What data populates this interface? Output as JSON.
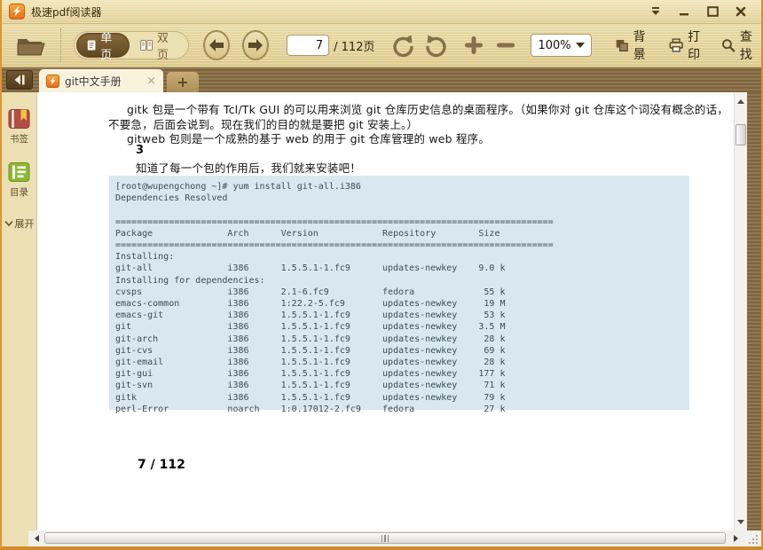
{
  "window": {
    "title": "极速pdf阅读器"
  },
  "toolbar": {
    "single_page_label": "单页",
    "double_page_label": "双页",
    "page_current": "7",
    "page_total": "/ 112页",
    "zoom_value": "100%",
    "background_label": "背景",
    "print_label": "打印",
    "find_label": "查找"
  },
  "tabbar": {
    "active_tab_title": "git中文手册",
    "close_glyph": "×",
    "new_tab_glyph": "+"
  },
  "sidebar": {
    "bookmark_label": "书签",
    "toc_label": "目录",
    "expand_label": "展开"
  },
  "document": {
    "paragraph_lines": [
      "gitk 包是一个带有 Tcl/Tk GUI 的可以用来浏览 git 仓库历史信息的桌面程序。（如果你对 git 仓库这个词没有概念的话，",
      "不要急，后面会说到。现在我们的目的就是要把 git 安装上。）",
      "gitweb 包则是一个成熟的基于 web 的用于 git 仓库管理的 web 程序。",
      "3",
      "知道了每一个包的作用后，我们就来安装吧！"
    ],
    "terminal_lines": [
      "[root@wupengchong ~]# yum install git-all.i386",
      "Dependencies Resolved",
      "",
      "==================================================================================",
      "Package              Arch      Version            Repository        Size",
      "==================================================================================",
      "Installing:",
      "git-all              i386      1.5.5.1-1.fc9      updates-newkey    9.0 k",
      "Installing for dependencies:",
      "cvsps                i386      2.1-6.fc9          fedora             55 k",
      "emacs-common         i386      1:22.2-5.fc9       updates-newkey     19 M",
      "emacs-git            i386      1.5.5.1-1.fc9      updates-newkey     53 k",
      "git                  i386      1.5.5.1-1.fc9      updates-newkey    3.5 M",
      "git-arch             i386      1.5.5.1-1.fc9      updates-newkey     28 k",
      "git-cvs              i386      1.5.5.1-1.fc9      updates-newkey     69 k",
      "git-email            i386      1.5.5.1-1.fc9      updates-newkey     28 k",
      "git-gui              i386      1.5.5.1-1.fc9      updates-newkey    177 k",
      "git-svn              i386      1.5.5.1-1.fc9      updates-newkey     71 k",
      "gitk                 i386      1.5.5.1-1.fc9      updates-newkey     79 k",
      "perl-Error           noarch    1:0.17012-2.fc9    fedora             27 k"
    ],
    "page_footer": "7 / 112"
  },
  "colors": {
    "frame_orange": "#e0952f",
    "chrome_tan": "#e9dba7",
    "tab_brown": "#8b6f46",
    "active_pill_brown": "#5e4620",
    "terminal_bg": "#d9e8f0"
  }
}
